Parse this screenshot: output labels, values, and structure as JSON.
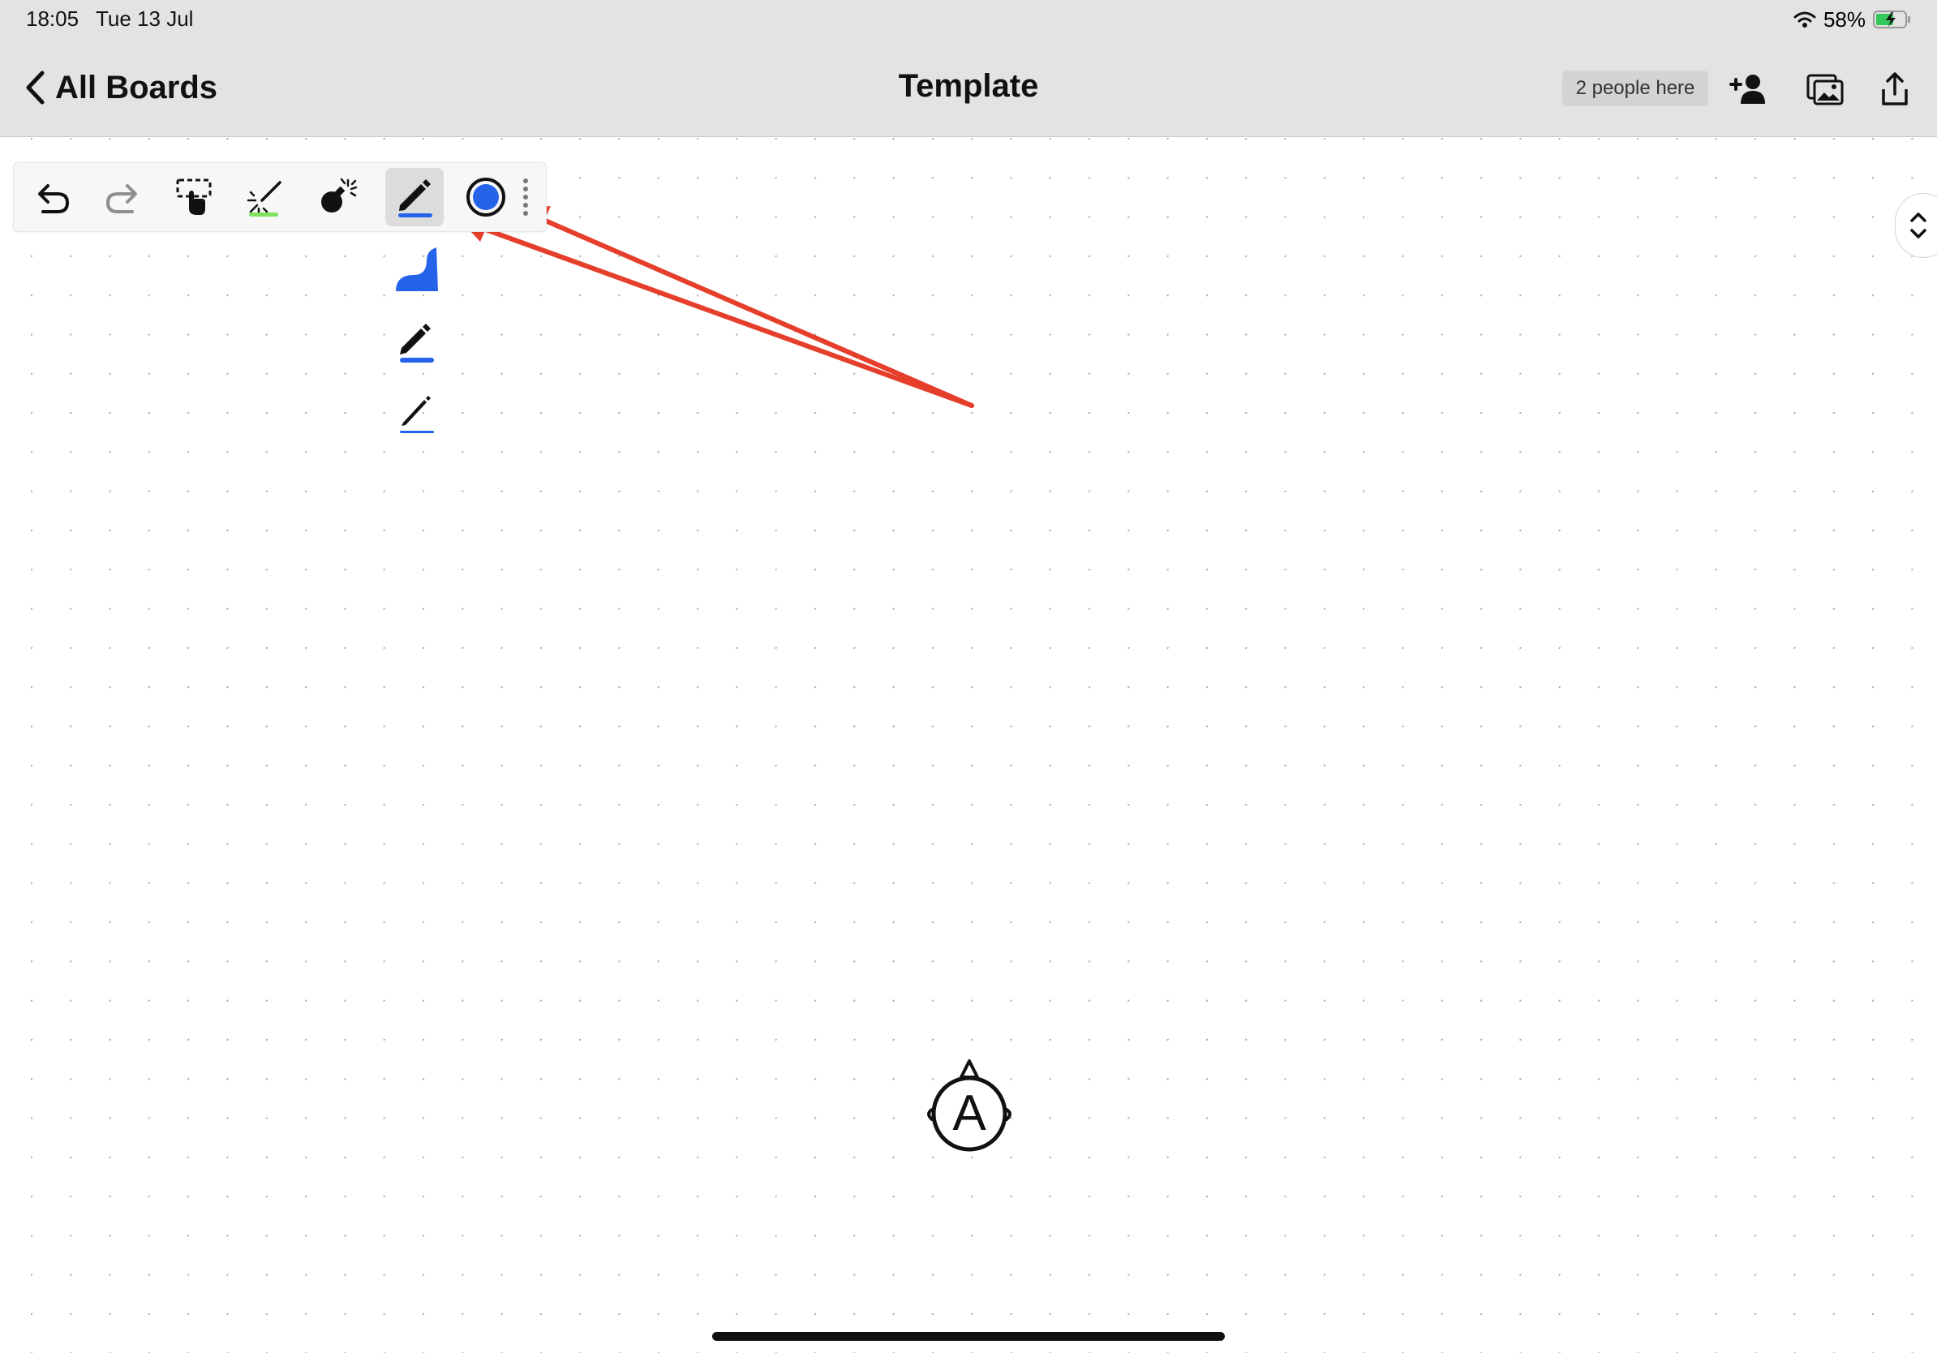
{
  "status_bar": {
    "time": "18:05",
    "date": "Tue 13 Jul",
    "battery": "58%"
  },
  "header": {
    "back_label": "All Boards",
    "title": "Template",
    "people_badge": "2 people here",
    "icons": [
      "add-person-icon",
      "image-library-icon",
      "share-icon"
    ]
  },
  "toolbar": {
    "tools": [
      "undo-icon",
      "redo-icon",
      "lasso-select-icon",
      "laser-pointer-icon",
      "bomb-icon",
      "pen-icon",
      "color-picker-icon",
      "more-icon"
    ],
    "selected_tool": "pen",
    "selected_color": "#2563eb",
    "stroke_options": [
      "fountain-pen-stroke-icon",
      "marker-stroke-icon",
      "fine-pen-stroke-icon"
    ]
  },
  "avatar": {
    "letter": "A"
  },
  "colors": {
    "accent": "#2563eb",
    "annotation": "#e53e2b",
    "bar": "#e3e3e3"
  }
}
